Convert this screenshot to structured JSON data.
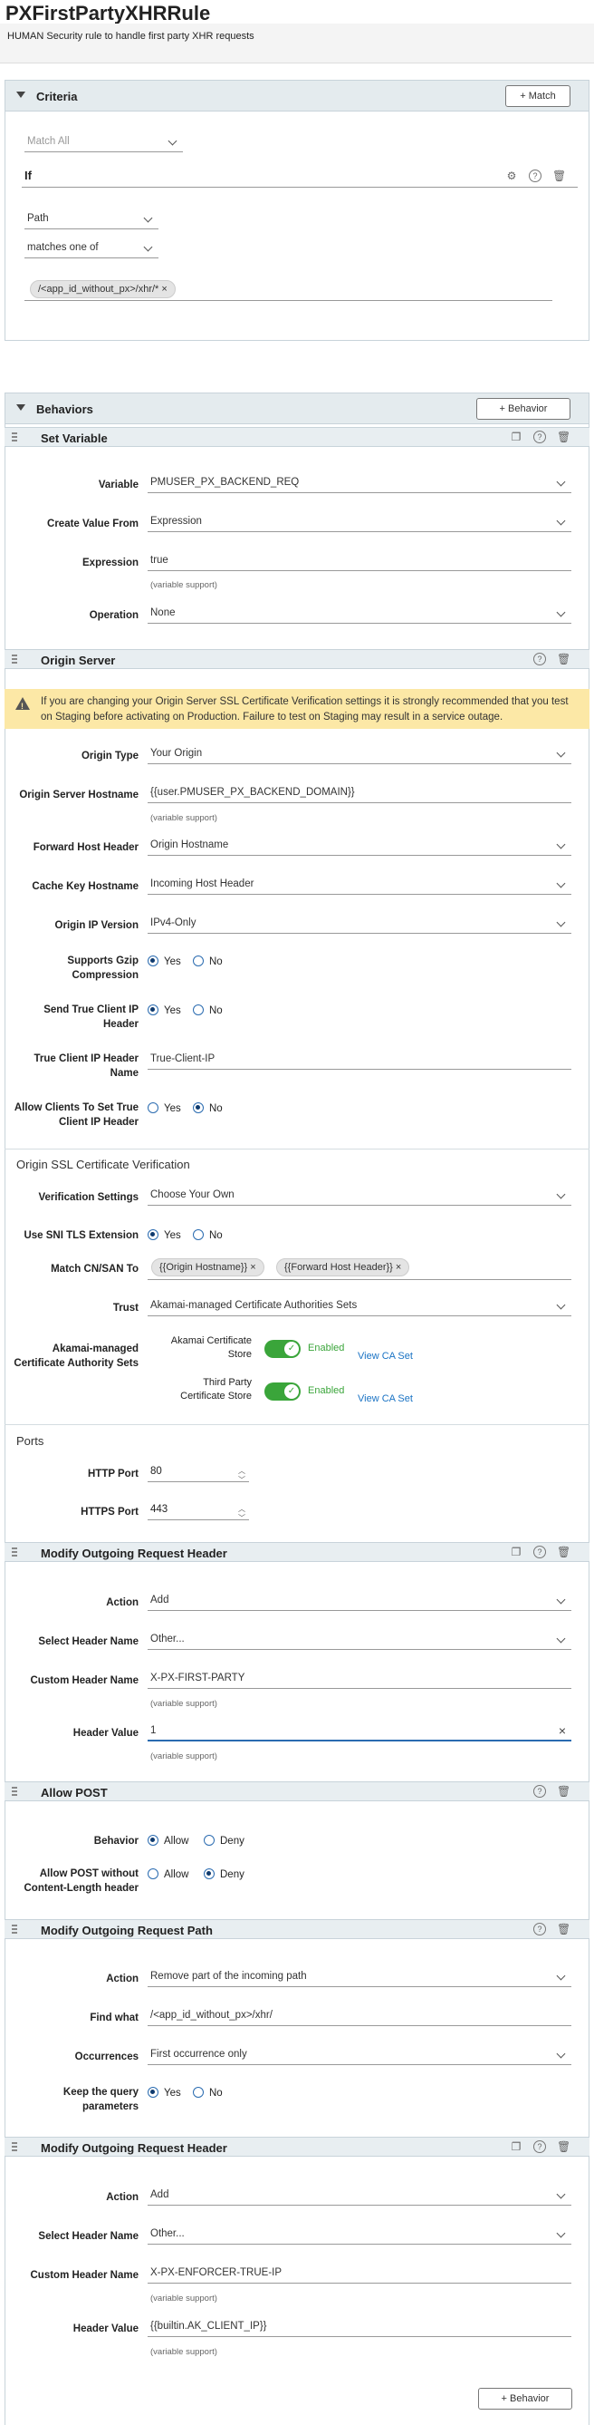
{
  "rule": {
    "title": "PXFirstPartyXHRRule",
    "description": "HUMAN Security rule to handle first party XHR requests"
  },
  "criteria": {
    "title": "Criteria",
    "match_button": "+ Match",
    "match_all": "Match All",
    "if_label": "If",
    "condition_field": "Path",
    "operator": "matches one of",
    "value_chip": "/<app_id_without_px>/xhr/*"
  },
  "behaviors": {
    "title": "Behaviors",
    "add_button": "+ Behavior",
    "add_button_bottom": "+ Behavior"
  },
  "set_variable": {
    "title": "Set Variable",
    "variable_label": "Variable",
    "variable_value": "PMUSER_PX_BACKEND_REQ",
    "create_from_label": "Create Value From",
    "create_from_value": "Expression",
    "expression_label": "Expression",
    "expression_value": "true",
    "expression_note": "(variable support)",
    "operation_label": "Operation",
    "operation_value": "None"
  },
  "origin_server": {
    "title": "Origin Server",
    "warning": "If you are changing your Origin Server SSL Certificate Verification settings it is strongly recommended that you test on Staging before activating on Production. Failure to test on Staging may result in a service outage.",
    "origin_type_label": "Origin Type",
    "origin_type_value": "Your Origin",
    "hostname_label": "Origin Server Hostname",
    "hostname_value": "{{user.PMUSER_PX_BACKEND_DOMAIN}}",
    "hostname_note": "(variable support)",
    "fwd_host_label": "Forward Host Header",
    "fwd_host_value": "Origin Hostname",
    "cache_key_label": "Cache Key Hostname",
    "cache_key_value": "Incoming Host Header",
    "ip_version_label": "Origin IP Version",
    "ip_version_value": "IPv4-Only",
    "gzip_label_1": "Supports Gzip",
    "gzip_label_2": "Compression",
    "true_ip_label_1": "Send True Client IP",
    "true_ip_label_2": "Header",
    "true_ip_name_label_1": "True Client IP Header",
    "true_ip_name_label_2": "Name",
    "true_ip_name_value": "True-Client-IP",
    "allow_clients_label_1": "Allow Clients To Set True",
    "allow_clients_label_2": "Client IP Header",
    "yes": "Yes",
    "no": "No",
    "ssl_title": "Origin SSL Certificate Verification",
    "verif_label": "Verification Settings",
    "verif_value": "Choose Your Own",
    "sni_label": "Use SNI TLS Extension",
    "cn_label": "Match CN/SAN To",
    "cn_chip_1": "{{Origin Hostname}}",
    "cn_chip_2": "{{Forward Host Header}}",
    "trust_label": "Trust",
    "trust_value": "Akamai-managed Certificate Authorities Sets",
    "akamai_sets_label_1": "Akamai-managed",
    "akamai_sets_label_2": "Certificate Authority Sets",
    "akamai_store_1": "Akamai Certificate",
    "akamai_store_2": "Store",
    "third_store_1": "Third Party",
    "third_store_2": "Certificate Store",
    "enabled": "Enabled",
    "view_ca": "View CA Set",
    "ports_title": "Ports",
    "http_port_label": "HTTP Port",
    "http_port_value": "80",
    "https_port_label": "HTTPS Port",
    "https_port_value": "443"
  },
  "req_header_1": {
    "title": "Modify Outgoing Request Header",
    "action_label": "Action",
    "action_value": "Add",
    "select_label": "Select Header Name",
    "select_value": "Other...",
    "custom_label": "Custom Header Name",
    "custom_value": "X-PX-FIRST-PARTY",
    "custom_note": "(variable support)",
    "value_label": "Header Value",
    "value_value": "1",
    "value_note": "(variable support)"
  },
  "allow_post": {
    "title": "Allow POST",
    "behavior_label": "Behavior",
    "no_len_label_1": "Allow POST without",
    "no_len_label_2": "Content-Length header",
    "allow": "Allow",
    "deny": "Deny"
  },
  "req_path": {
    "title": "Modify Outgoing Request Path",
    "action_label": "Action",
    "action_value": "Remove part of the incoming path",
    "find_label": "Find what",
    "find_value": "/<app_id_without_px>/xhr/",
    "occ_label": "Occurrences",
    "occ_value": "First occurrence only",
    "keep_label_1": "Keep the query",
    "keep_label_2": "parameters",
    "yes": "Yes",
    "no": "No"
  },
  "req_header_2": {
    "title": "Modify Outgoing Request Header",
    "action_label": "Action",
    "action_value": "Add",
    "select_label": "Select Header Name",
    "select_value": "Other...",
    "custom_label": "Custom Header Name",
    "custom_value": "X-PX-ENFORCER-TRUE-IP",
    "custom_note": "(variable support)",
    "value_label": "Header Value",
    "value_value": "{{builtin.AK_CLIENT_IP}}",
    "value_note": "(variable support)"
  }
}
